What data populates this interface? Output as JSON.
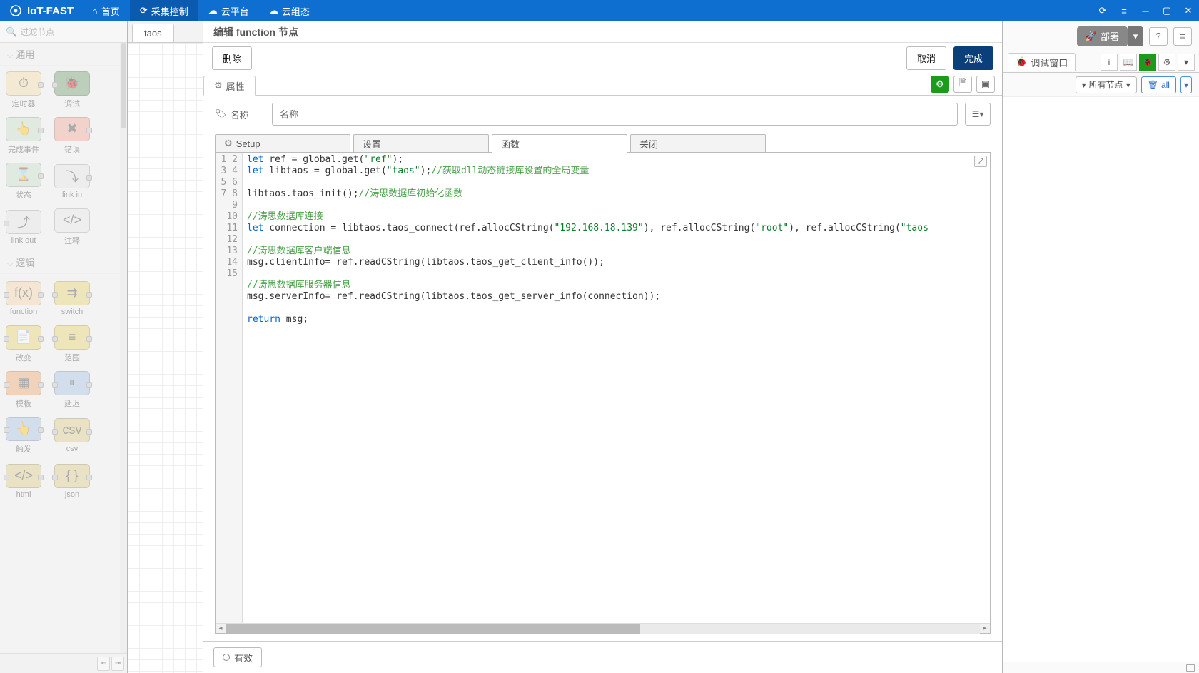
{
  "app": {
    "name": "IoT-FAST"
  },
  "nav": {
    "home": "首页",
    "collect": "采集控制",
    "cloud": "云平台",
    "hmi": "云组态"
  },
  "palette": {
    "search_placeholder": "过滤节点",
    "categories": {
      "common": "通用",
      "logic": "逻辑"
    },
    "nodes": {
      "inject": "定时器",
      "debug": "调试",
      "complete": "完成事件",
      "catch": "错误",
      "status": "状态",
      "link_in": "link in",
      "link_out": "link out",
      "comment": "注释",
      "function": "function",
      "switch": "switch",
      "change": "改变",
      "range": "范围",
      "template": "模板",
      "delay": "延迟",
      "trigger": "触发",
      "csv": "csv",
      "html": "html",
      "json": "json"
    }
  },
  "tabs": {
    "flow1": "taos"
  },
  "editor": {
    "title": "编辑 function 节点",
    "delete": "删除",
    "cancel": "取消",
    "done": "完成",
    "prop_tab": "属性",
    "name_label": "名称",
    "name_placeholder": "名称",
    "code_tabs": {
      "setup": "Setup",
      "settings": "设置",
      "func": "函数",
      "close": "关闭"
    },
    "code": {
      "l1_a": "let",
      "l1_b": " ref = global.get(",
      "l1_c": "\"ref\"",
      "l1_d": ");",
      "l2_a": "let",
      "l2_b": " libtaos = global.get(",
      "l2_c": "\"taos\"",
      "l2_d": ");",
      "l2_e": "//获取dll动态链接库设置的全局变量",
      "l4_a": "libtaos.taos_init();",
      "l4_b": "//涛思数据库初始化函数",
      "l6": "//涛思数据库连接",
      "l7_a": "let",
      "l7_b": " connection = libtaos.taos_connect(ref.allocCString(",
      "l7_c": "\"192.168.18.139\"",
      "l7_d": "), ref.allocCString(",
      "l7_e": "\"root\"",
      "l7_f": "), ref.allocCString(",
      "l7_g": "\"taos",
      "l9": "//涛思数据库客户端信息",
      "l10": "msg.clientInfo= ref.readCString(libtaos.taos_get_client_info());",
      "l12": "//涛思数据库服务器信息",
      "l13": "msg.serverInfo= ref.readCString(libtaos.taos_get_server_info(connection));",
      "l15_a": "return",
      "l15_b": " msg;"
    },
    "enable": "有效"
  },
  "rsidebar": {
    "deploy": "部署",
    "debug_tab": "调试窗口",
    "filter_all_nodes": "所有节点",
    "filter_all": "all"
  }
}
